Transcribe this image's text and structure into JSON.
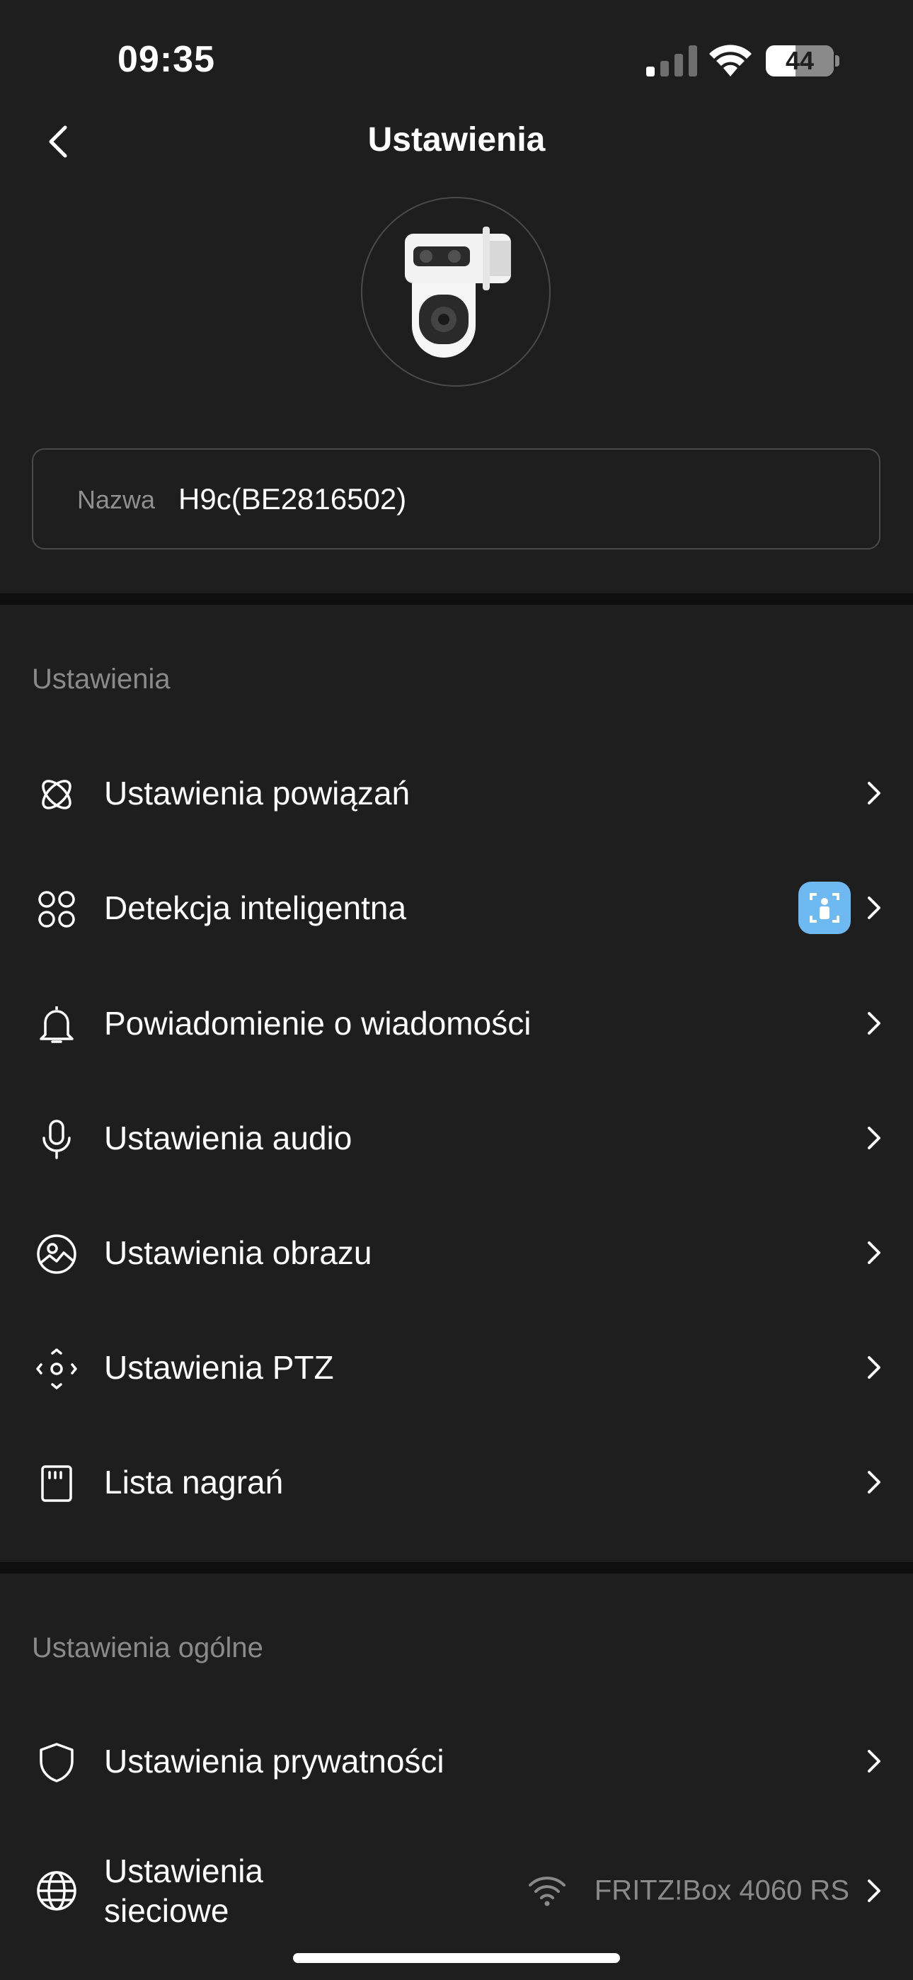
{
  "status_bar": {
    "time": "09:35",
    "battery": "44",
    "battery_level": 0.44
  },
  "header": {
    "title": "Ustawienia"
  },
  "device": {
    "name_label": "Nazwa",
    "name_value": "H9c(BE2816502)"
  },
  "sections": {
    "settings": {
      "title": "Ustawienia",
      "items": [
        {
          "label": "Ustawienia powiązań",
          "icon": "linkage-icon"
        },
        {
          "label": "Detekcja inteligentna",
          "icon": "grid-circles-icon",
          "badge": "ai-person-badge-icon"
        },
        {
          "label": "Powiadomienie o wiadomości",
          "icon": "bell-icon"
        },
        {
          "label": "Ustawienia audio",
          "icon": "microphone-icon"
        },
        {
          "label": "Ustawienia obrazu",
          "icon": "image-icon"
        },
        {
          "label": "Ustawienia PTZ",
          "icon": "ptz-icon"
        },
        {
          "label": "Lista nagrań",
          "icon": "sd-card-icon"
        }
      ]
    },
    "general": {
      "title": "Ustawienia ogólne",
      "items": [
        {
          "label": "Ustawienia prywatności",
          "icon": "shield-icon"
        },
        {
          "label_line1": "Ustawienia",
          "label_line2": "sieciowe",
          "value": "FRITZ!Box 4060 RS",
          "icon": "globe-icon"
        }
      ]
    }
  },
  "colors": {
    "background": "#1e1e1e",
    "divider": "#0f0f0f",
    "secondary_text": "#8a8a8a",
    "badge": "#6eb9f2"
  }
}
